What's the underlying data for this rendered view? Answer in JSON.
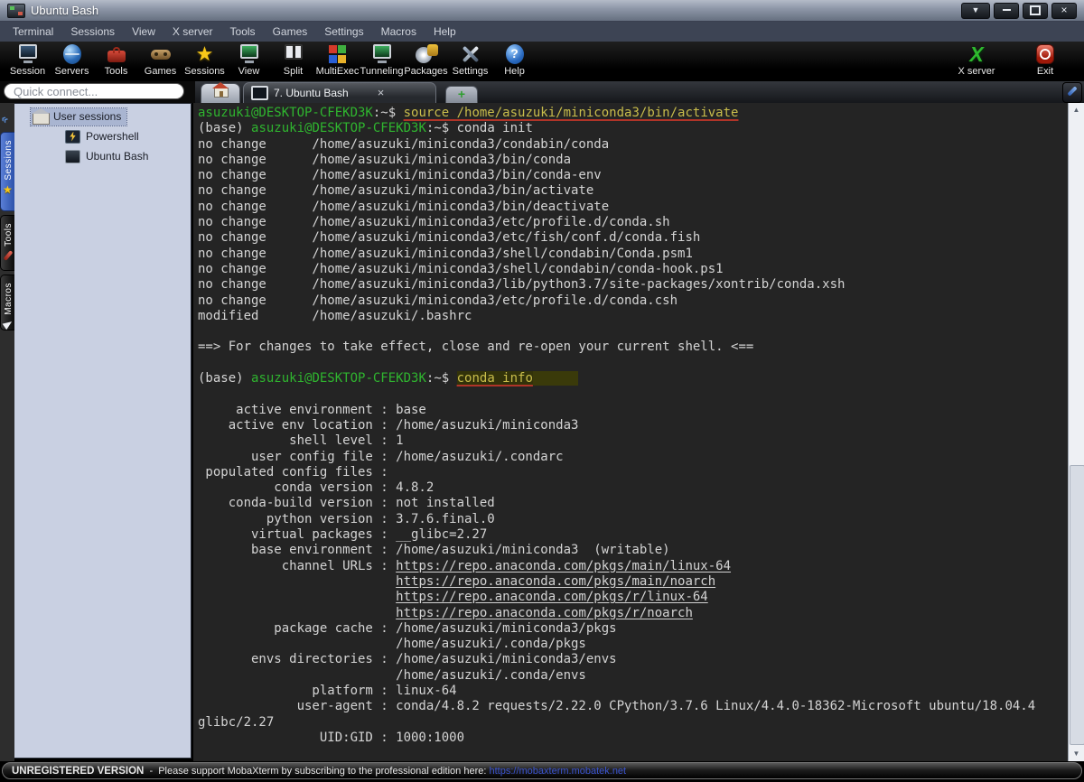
{
  "titlebar": {
    "title": "Ubuntu Bash"
  },
  "glyphs": {
    "dropdown": "▼",
    "close": "×",
    "tab_close": "×",
    "new_tab": "+",
    "collapse": "«",
    "scroll_up": "▲",
    "scroll_down": "▼"
  },
  "menubar": {
    "items": [
      "Terminal",
      "Sessions",
      "View",
      "X server",
      "Tools",
      "Games",
      "Settings",
      "Macros",
      "Help"
    ]
  },
  "toolbar": {
    "left": [
      {
        "label": "Session",
        "icon": "monitor"
      },
      {
        "label": "Servers",
        "icon": "globe"
      },
      {
        "label": "Tools",
        "icon": "toolbox"
      },
      {
        "label": "Games",
        "icon": "gamepad"
      },
      {
        "label": "Sessions",
        "icon": "star"
      },
      {
        "label": "View",
        "icon": "monitor-green"
      },
      {
        "label": "Split",
        "icon": "split"
      },
      {
        "label": "MultiExec",
        "icon": "grid"
      },
      {
        "label": "Tunneling",
        "icon": "monitor-green"
      },
      {
        "label": "Packages",
        "icon": "cd"
      },
      {
        "label": "Settings",
        "icon": "xtools"
      },
      {
        "label": "Help",
        "icon": "help"
      }
    ],
    "right": [
      {
        "label": "X server",
        "icon": "xserver"
      },
      {
        "label": "Exit",
        "icon": "power"
      }
    ]
  },
  "quick_connect": {
    "placeholder": "Quick connect..."
  },
  "sidebar": {
    "tabs": [
      {
        "label": "Sessions",
        "icon": "star",
        "active": true
      },
      {
        "label": "Tools",
        "icon": "tools",
        "active": false
      },
      {
        "label": "Macros",
        "icon": "paper-plane",
        "active": false
      }
    ],
    "tree": {
      "root": {
        "label": "User sessions",
        "icon": "home",
        "selected": true
      },
      "children": [
        {
          "label": "Powershell",
          "icon": "powershell"
        },
        {
          "label": "Ubuntu Bash",
          "icon": "terminal"
        }
      ]
    }
  },
  "tabs": {
    "active_label": "7. Ubuntu Bash"
  },
  "terminal": {
    "lines": [
      [
        [
          "g",
          "asuzuki@DESKTOP-CFEKD3K"
        ],
        [
          "w",
          ":~$ "
        ],
        [
          "y",
          "source /home/asuzuki/miniconda3/bin/activate"
        ]
      ],
      [
        [
          "w",
          "(base) "
        ],
        [
          "g",
          "asuzuki@DESKTOP-CFEKD3K"
        ],
        [
          "w",
          ":~$ conda init"
        ]
      ],
      "no change      /home/asuzuki/miniconda3/condabin/conda",
      "no change      /home/asuzuki/miniconda3/bin/conda",
      "no change      /home/asuzuki/miniconda3/bin/conda-env",
      "no change      /home/asuzuki/miniconda3/bin/activate",
      "no change      /home/asuzuki/miniconda3/bin/deactivate",
      "no change      /home/asuzuki/miniconda3/etc/profile.d/conda.sh",
      "no change      /home/asuzuki/miniconda3/etc/fish/conf.d/conda.fish",
      "no change      /home/asuzuki/miniconda3/shell/condabin/Conda.psm1",
      "no change      /home/asuzuki/miniconda3/shell/condabin/conda-hook.ps1",
      "no change      /home/asuzuki/miniconda3/lib/python3.7/site-packages/xontrib/conda.xsh",
      "no change      /home/asuzuki/miniconda3/etc/profile.d/conda.csh",
      "modified       /home/asuzuki/.bashrc",
      "",
      "==> For changes to take effect, close and re-open your current shell. <==",
      "",
      [
        [
          "w",
          "(base) "
        ],
        [
          "g",
          "asuzuki@DESKTOP-CFEKD3K"
        ],
        [
          "w",
          ":~$ "
        ],
        [
          "yh",
          "conda info"
        ],
        [
          "t",
          "      "
        ]
      ],
      "",
      "     active environment : base",
      "    active env location : /home/asuzuki/miniconda3",
      "            shell level : 1",
      "       user config file : /home/asuzuki/.condarc",
      " populated config files : ",
      "          conda version : 4.8.2",
      "    conda-build version : not installed",
      "         python version : 3.7.6.final.0",
      "       virtual packages : __glibc=2.27",
      "       base environment : /home/asuzuki/miniconda3  (writable)",
      [
        [
          "w",
          "           channel URLs : "
        ],
        [
          "l",
          "https://repo.anaconda.com/pkgs/main/linux-64"
        ]
      ],
      [
        [
          "w",
          "                          "
        ],
        [
          "l",
          "https://repo.anaconda.com/pkgs/main/noarch"
        ]
      ],
      [
        [
          "w",
          "                          "
        ],
        [
          "l",
          "https://repo.anaconda.com/pkgs/r/linux-64"
        ]
      ],
      [
        [
          "w",
          "                          "
        ],
        [
          "l",
          "https://repo.anaconda.com/pkgs/r/noarch"
        ]
      ],
      "          package cache : /home/asuzuki/miniconda3/pkgs",
      "                          /home/asuzuki/.conda/pkgs",
      "       envs directories : /home/asuzuki/miniconda3/envs",
      "                          /home/asuzuki/.conda/envs",
      "               platform : linux-64",
      "             user-agent : conda/4.8.2 requests/2.22.0 CPython/3.7.6 Linux/4.4.0-18362-Microsoft ubuntu/18.04.4",
      "glibc/2.27",
      "                UID:GID : 1000:1000"
    ]
  },
  "statusbar": {
    "registered": "UNREGISTERED VERSION",
    "message": "  -  Please support MobaXterm by subscribing to the professional edition here: ",
    "link": "https://mobaxterm.mobatek.net"
  },
  "colors": {
    "terminal_bg": "#242424",
    "terminal_fg": "#d4d4d4",
    "prompt_green": "#2fb52f",
    "command_yellow": "#c9bd4b",
    "underline_red": "#b03428",
    "highlight_olive": "#32320a",
    "link_blue": "#3b54d0",
    "sessions_tab_blue": "#2a4fa8",
    "star_yellow": "#f8c819",
    "xserver_green": "#2eb82e",
    "exit_red": "#a01808",
    "sidebar_bg": "#c9d0e2",
    "titlebar_top": "#b4bbc8",
    "menubar_bg": "#3d4454"
  }
}
